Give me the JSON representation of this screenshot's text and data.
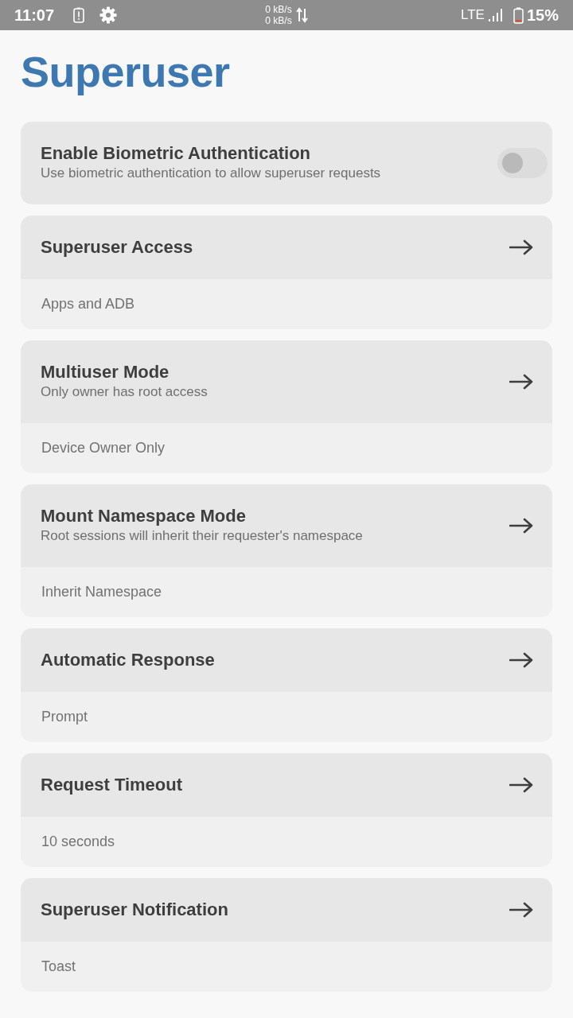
{
  "status_bar": {
    "time": "11:07",
    "net_speed": [
      "0 kB/s",
      "0 kB/s"
    ],
    "network": "LTE",
    "battery": "15%"
  },
  "title": "Superuser",
  "settings": [
    {
      "kind": "toggle",
      "title": "Enable Biometric Authentication",
      "subtitle": "Use biometric authentication to allow superuser requests",
      "on": false
    },
    {
      "kind": "link",
      "title": "Superuser Access",
      "value": "Apps and ADB"
    },
    {
      "kind": "link",
      "title": "Multiuser Mode",
      "subtitle": "Only owner has root access",
      "value": "Device Owner Only"
    },
    {
      "kind": "link",
      "title": "Mount Namespace Mode",
      "subtitle": "Root sessions will inherit their requester's namespace",
      "value": "Inherit Namespace"
    },
    {
      "kind": "link",
      "title": "Automatic Response",
      "value": "Prompt"
    },
    {
      "kind": "link",
      "title": "Request Timeout",
      "value": "10 seconds"
    },
    {
      "kind": "link",
      "title": "Superuser Notification",
      "value": "Toast"
    }
  ]
}
